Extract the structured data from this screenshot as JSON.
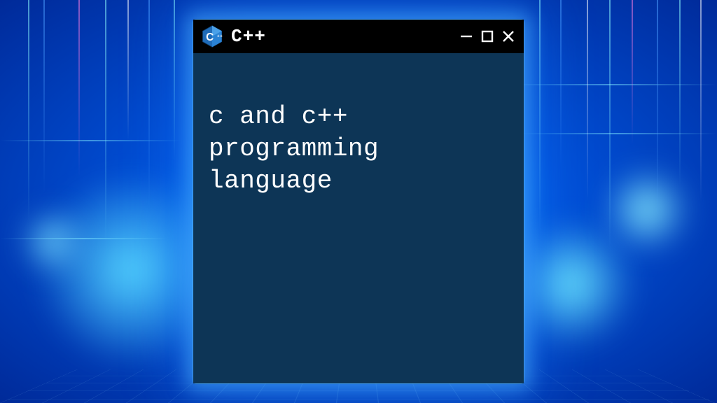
{
  "window": {
    "title": "C++",
    "logo_letter": "C",
    "controls": {
      "minimize": "minimize",
      "maximize": "maximize",
      "close": "close"
    }
  },
  "terminal": {
    "content": "c and c++\nprogramming\nlanguage",
    "bg_color": "#0d3556",
    "text_color": "#ffffff"
  },
  "icons": {
    "logo": "cpp-hex-icon",
    "minimize": "minimize-icon",
    "maximize": "maximize-icon",
    "close": "close-icon"
  }
}
